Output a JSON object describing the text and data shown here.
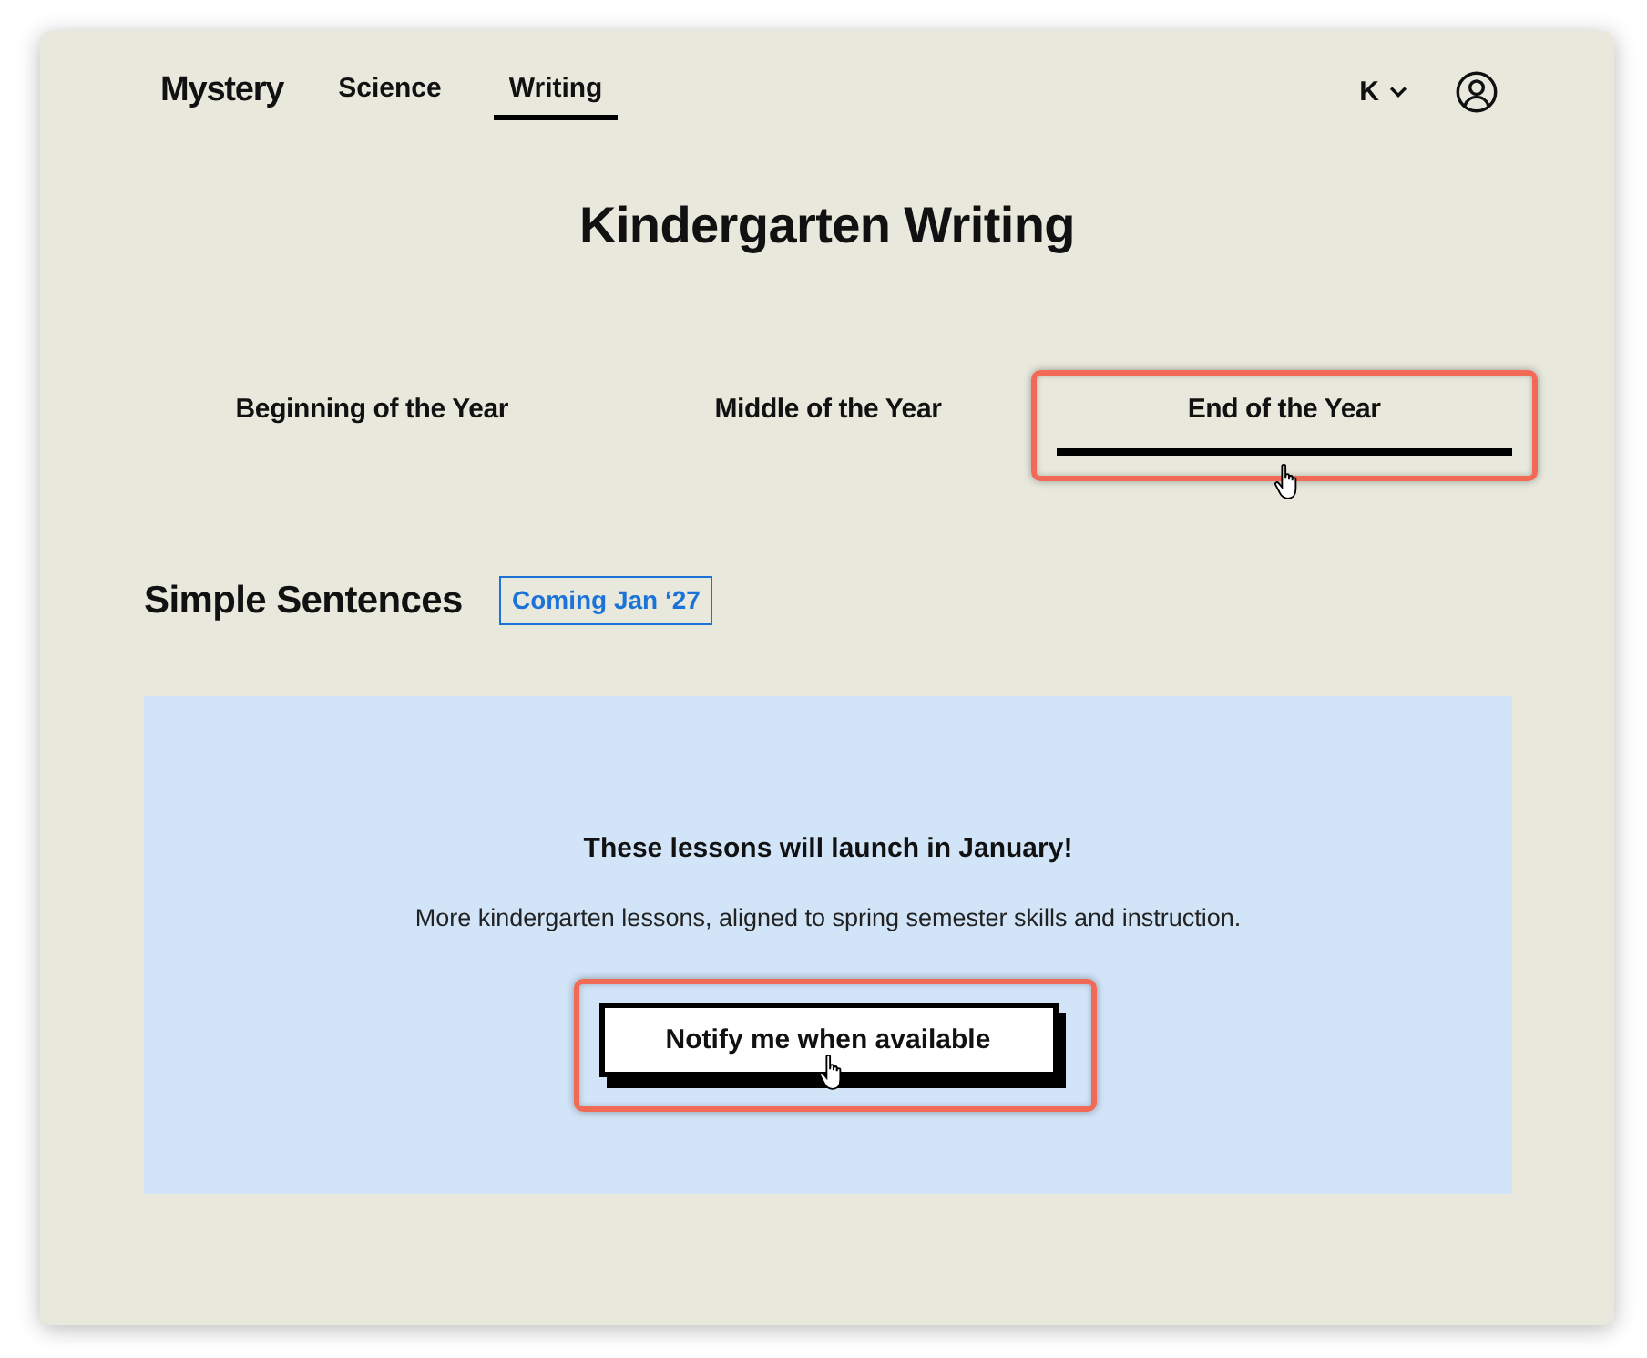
{
  "nav": {
    "logo": "Mystery",
    "links": [
      {
        "label": "Science",
        "selected": false
      },
      {
        "label": "Writing",
        "selected": true
      }
    ],
    "grade": "K"
  },
  "title": "Kindergarten Writing",
  "tabs": [
    {
      "label": "Beginning of the Year",
      "selected": false,
      "highlighted": false
    },
    {
      "label": "Middle of the Year",
      "selected": false,
      "highlighted": false
    },
    {
      "label": "End of the Year",
      "selected": true,
      "highlighted": true
    }
  ],
  "section": {
    "heading": "Simple Sentences",
    "badge": "Coming Jan ‘27"
  },
  "notice": {
    "heading": "These lessons will launch in January!",
    "text": "More kindergarten lessons, aligned to spring semester skills and instruction.",
    "button": {
      "label": "Notify me when available",
      "highlighted": true
    }
  }
}
